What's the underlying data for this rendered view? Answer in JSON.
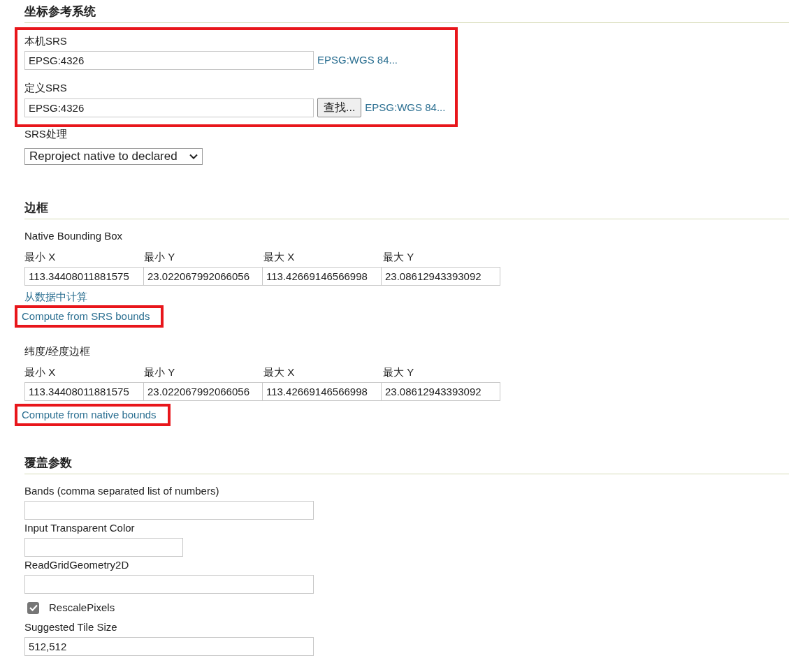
{
  "crs_section": {
    "title": "坐标参考系统",
    "highlighted": true,
    "native_srs": {
      "label": "本机SRS",
      "value": "EPSG:4326",
      "link": "EPSG:WGS 84..."
    },
    "declared_srs": {
      "label": "定义SRS",
      "value": "EPSG:4326",
      "button": "查找...",
      "link": "EPSG:WGS 84..."
    },
    "srs_handling": {
      "label": "SRS处理",
      "value": "Reproject native to declared"
    }
  },
  "bbox_section": {
    "title": "边框",
    "boxes": [
      {
        "title": "Native Bounding Box",
        "columns": [
          "最小 X",
          "最小 Y",
          "最大 X",
          "最大 Y"
        ],
        "values": [
          "113.34408011881575",
          "23.022067992066056",
          "113.42669146566998",
          "23.08612943393092"
        ],
        "actions": [
          {
            "label": "从数据中计算",
            "highlighted": false
          },
          {
            "label": "Compute from SRS bounds",
            "highlighted": true
          }
        ]
      },
      {
        "title": "纬度/经度边框",
        "columns": [
          "最小 X",
          "最小 Y",
          "最大 X",
          "最大 Y"
        ],
        "values": [
          "113.34408011881575",
          "23.022067992066056",
          "113.42669146566998",
          "23.08612943393092"
        ],
        "actions": [
          {
            "label": "Compute from native bounds",
            "highlighted": true
          }
        ]
      }
    ]
  },
  "coverage_section": {
    "title": "覆盖参数",
    "fields": [
      {
        "kind": "text",
        "label": "Bands (comma separated list of numbers)"
      },
      {
        "kind": "short_text",
        "label": "Input Transparent Color"
      },
      {
        "kind": "text",
        "label": "ReadGridGeometry2D"
      },
      {
        "kind": "checkbox",
        "label": "RescalePixels",
        "checked": true
      },
      {
        "kind": "text",
        "label": "Suggested Tile Size",
        "value": "512,512"
      }
    ]
  }
}
